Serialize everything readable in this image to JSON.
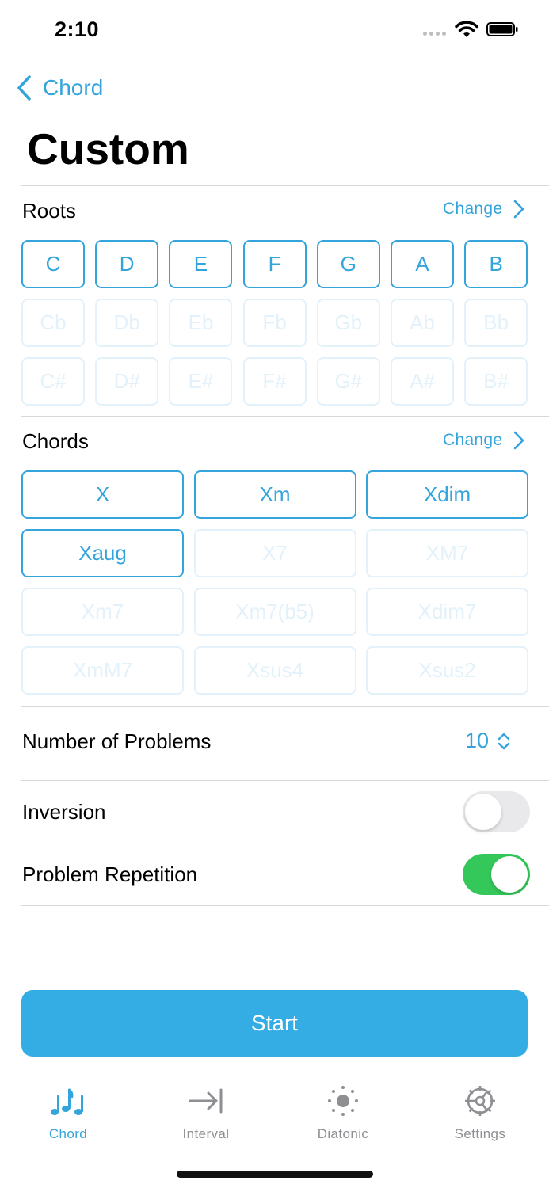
{
  "status_bar": {
    "time": "2:10"
  },
  "nav": {
    "back_label": "Chord",
    "title": "Custom"
  },
  "roots": {
    "title": "Roots",
    "change_label": "Change",
    "rows": [
      [
        {
          "label": "C",
          "on": true
        },
        {
          "label": "D",
          "on": true
        },
        {
          "label": "E",
          "on": true
        },
        {
          "label": "F",
          "on": true
        },
        {
          "label": "G",
          "on": true
        },
        {
          "label": "A",
          "on": true
        },
        {
          "label": "B",
          "on": true
        }
      ],
      [
        {
          "label": "Cb",
          "on": false
        },
        {
          "label": "Db",
          "on": false
        },
        {
          "label": "Eb",
          "on": false
        },
        {
          "label": "Fb",
          "on": false
        },
        {
          "label": "Gb",
          "on": false
        },
        {
          "label": "Ab",
          "on": false
        },
        {
          "label": "Bb",
          "on": false
        }
      ],
      [
        {
          "label": "C#",
          "on": false
        },
        {
          "label": "D#",
          "on": false
        },
        {
          "label": "E#",
          "on": false
        },
        {
          "label": "F#",
          "on": false
        },
        {
          "label": "G#",
          "on": false
        },
        {
          "label": "A#",
          "on": false
        },
        {
          "label": "B#",
          "on": false
        }
      ]
    ]
  },
  "chords": {
    "title": "Chords",
    "change_label": "Change",
    "rows": [
      [
        {
          "label": "X",
          "on": true
        },
        {
          "label": "Xm",
          "on": true
        },
        {
          "label": "Xdim",
          "on": true
        }
      ],
      [
        {
          "label": "Xaug",
          "on": true
        },
        {
          "label": "X7",
          "on": false
        },
        {
          "label": "XM7",
          "on": false
        }
      ],
      [
        {
          "label": "Xm7",
          "on": false
        },
        {
          "label": "Xm7(b5)",
          "on": false
        },
        {
          "label": "Xdim7",
          "on": false
        }
      ],
      [
        {
          "label": "XmM7",
          "on": false
        },
        {
          "label": "Xsus4",
          "on": false
        },
        {
          "label": "Xsus2",
          "on": false
        }
      ]
    ]
  },
  "settings": {
    "problems_label": "Number of Problems",
    "problems_value": "10",
    "inversion_label": "Inversion",
    "inversion_on": false,
    "repetition_label": "Problem Repetition",
    "repetition_on": true
  },
  "start_label": "Start",
  "tabs": [
    {
      "label": "Chord",
      "icon": "notes-icon",
      "active": true
    },
    {
      "label": "Interval",
      "icon": "interval-arrow-icon",
      "active": false
    },
    {
      "label": "Diatonic",
      "icon": "sun-dots-icon",
      "active": false
    },
    {
      "label": "Settings",
      "icon": "gear-icon",
      "active": false
    }
  ],
  "colors": {
    "accent": "#34a4dd",
    "start_button": "#34ace4",
    "toggle_on": "#34c759",
    "chip_disabled": "#e3f1fa"
  }
}
